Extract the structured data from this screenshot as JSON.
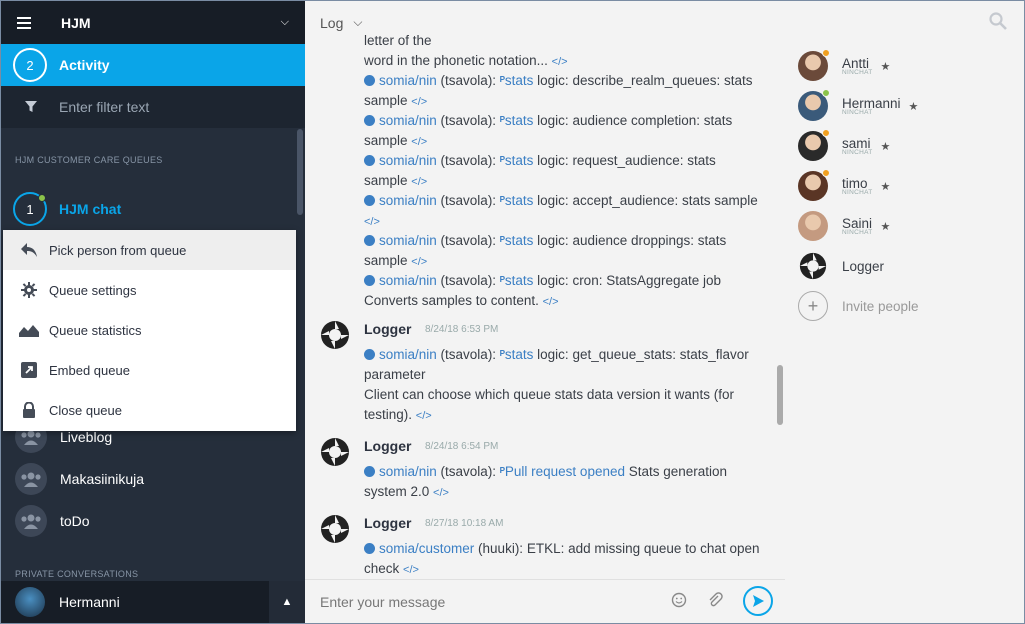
{
  "sidebar": {
    "header_title": "HJM",
    "activity": {
      "count": "2",
      "label": "Activity"
    },
    "filter_placeholder": "Enter filter text",
    "queues_heading": "HJM CUSTOMER CARE QUEUES",
    "queue": {
      "count": "1",
      "label": "HJM chat"
    },
    "rooms": [
      {
        "label": "Liveblog"
      },
      {
        "label": "Makasiinikuja"
      },
      {
        "label": "toDo"
      }
    ],
    "private_heading": "PRIVATE CONVERSATIONS",
    "current_user": "Hermanni"
  },
  "queue_menu": {
    "items": [
      {
        "label": "Pick person from queue",
        "icon": "reply-icon"
      },
      {
        "label": "Queue settings",
        "icon": "gear-icon"
      },
      {
        "label": "Queue statistics",
        "icon": "area-chart-icon"
      },
      {
        "label": "Embed queue",
        "icon": "external-link-icon"
      },
      {
        "label": "Close queue",
        "icon": "lock-icon"
      }
    ]
  },
  "topbar": {
    "channel": "Log"
  },
  "messages": {
    "lines": [
      {
        "pre": "",
        "link": "",
        "mid": "",
        "pr": "",
        "tag": "",
        "rest": "letter of the",
        "code": ""
      },
      {
        "pre": "",
        "link": "",
        "mid": "",
        "pr": "",
        "tag": "",
        "rest": "word in the phonetic notation...",
        "code": "</>"
      },
      {
        "link": "somia/nin",
        "mid": "(tsavola):",
        "tag": "stats",
        "rest": "logic: describe_realm_queues: stats",
        "code": ""
      },
      {
        "link": "",
        "mid": "",
        "tag": "",
        "rest": "sample",
        "code": "</>"
      },
      {
        "link": "somia/nin",
        "mid": "(tsavola):",
        "tag": "stats",
        "rest": "logic: audience completion: stats",
        "code": ""
      },
      {
        "link": "",
        "mid": "",
        "tag": "",
        "rest": "sample",
        "code": "</>"
      },
      {
        "link": "somia/nin",
        "mid": "(tsavola):",
        "tag": "stats",
        "rest": "logic: request_audience: stats",
        "code": ""
      },
      {
        "link": "",
        "mid": "",
        "tag": "",
        "rest": "sample",
        "code": "</>"
      },
      {
        "link": "somia/nin",
        "mid": "(tsavola):",
        "tag": "stats",
        "rest": "logic: accept_audience: stats sample",
        "code": ""
      },
      {
        "link": "",
        "mid": "",
        "tag": "",
        "rest": "",
        "code": "</>"
      },
      {
        "link": "somia/nin",
        "mid": "(tsavola):",
        "tag": "stats",
        "rest": "logic: audience droppings: stats",
        "code": ""
      },
      {
        "link": "",
        "mid": "",
        "tag": "",
        "rest": "sample",
        "code": "</>"
      },
      {
        "link": "somia/nin",
        "mid": "(tsavola):",
        "tag": "stats",
        "rest": "logic: cron: StatsAggregate job",
        "code": ""
      },
      {
        "link": "",
        "mid": "",
        "tag": "",
        "rest": "Converts samples to content.",
        "code": "</>"
      }
    ],
    "entries": [
      {
        "sender": "Logger",
        "time": "8/24/18 6:53 PM",
        "lines": [
          {
            "link": "somia/nin",
            "mid": "(tsavola):",
            "tag": "stats",
            "rest": "logic: get_queue_stats: stats_flavor",
            "code": ""
          },
          {
            "link": "",
            "mid": "",
            "tag": "",
            "rest": "parameter",
            "code": ""
          },
          {
            "link": "",
            "mid": "",
            "tag": "",
            "rest": "Client can choose which queue stats data version it wants (for",
            "code": ""
          },
          {
            "link": "",
            "mid": "",
            "tag": "",
            "rest": "testing).",
            "code": "</>"
          }
        ]
      },
      {
        "sender": "Logger",
        "time": "8/24/18 6:54 PM",
        "lines": [
          {
            "link": "somia/nin",
            "mid": "(tsavola):",
            "tag": "Pull request opened",
            "rest": "Stats generation",
            "code": ""
          },
          {
            "link": "",
            "mid": "",
            "tag": "",
            "rest": "system 2.0",
            "code": "</>"
          }
        ]
      },
      {
        "sender": "Logger",
        "time": "8/27/18 10:18 AM",
        "lines": [
          {
            "link": "somia/customer",
            "mid": "(huuki):",
            "tag": "",
            "rest": " ETKL: add missing queue to chat open",
            "code": ""
          },
          {
            "link": "",
            "mid": "",
            "tag": "",
            "rest": "check",
            "code": "</>"
          }
        ]
      }
    ]
  },
  "composer": {
    "placeholder": "Enter your message"
  },
  "users": {
    "list": [
      {
        "name": "Antti",
        "sub": "NINCHAT",
        "status_color": "#f0a020",
        "star": "★"
      },
      {
        "name": "Hermanni",
        "sub": "NINCHAT",
        "status_color": "#8bc34a",
        "star": "★"
      },
      {
        "name": "sami",
        "sub": "NINCHAT",
        "status_color": "#f0a020",
        "star": "★"
      },
      {
        "name": "timo",
        "sub": "NINCHAT",
        "status_color": "#f0a020",
        "star": "★"
      },
      {
        "name": "Saini",
        "sub": "NINCHAT",
        "status_color": "",
        "star": "★"
      },
      {
        "name": "Logger",
        "sub": "",
        "status_color": "",
        "star": ""
      }
    ],
    "invite_label": "Invite people"
  },
  "colors": {
    "accent": "#0aa5e8",
    "sidebar_bg": "#252e3b",
    "link": "#3b7fc4"
  }
}
